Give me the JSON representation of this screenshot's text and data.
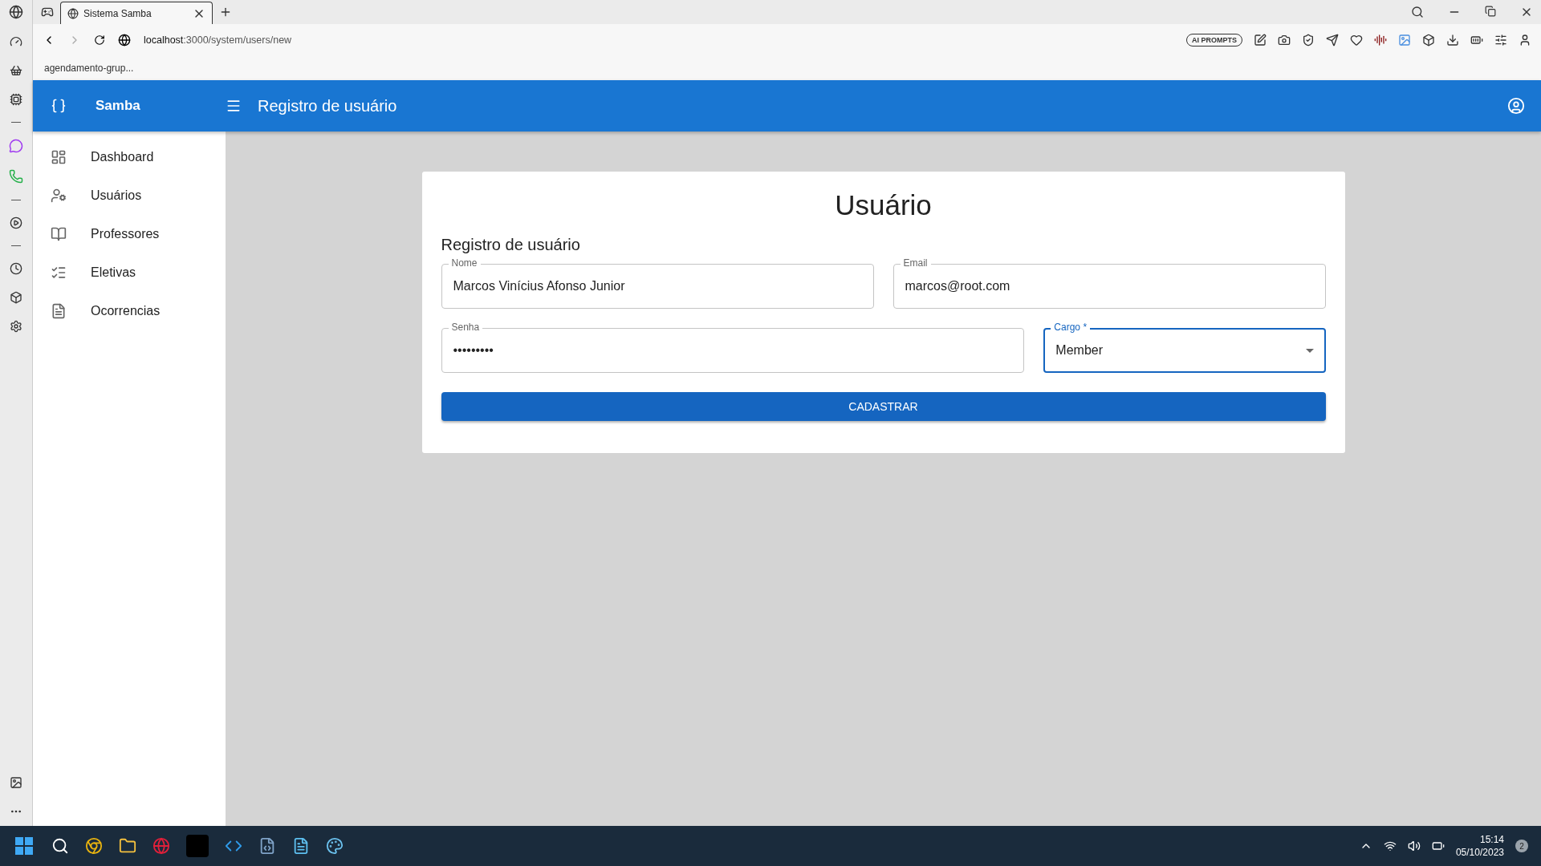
{
  "browser": {
    "tabs": [
      {
        "title": "Sistema Samba",
        "selected": true
      }
    ],
    "url_host": "localhost",
    "url_path": ":3000/system/users/new",
    "bookmarks": [
      "agendamento-grup..."
    ],
    "ai_prompts": "AI PROMPTS"
  },
  "app": {
    "brand": "Samba",
    "title": "Registro de usuário"
  },
  "sidebar": {
    "items": [
      {
        "label": "Dashboard"
      },
      {
        "label": "Usuários"
      },
      {
        "label": "Professores"
      },
      {
        "label": "Eletivas"
      },
      {
        "label": "Ocorrencias"
      }
    ]
  },
  "form": {
    "heading": "Usuário",
    "subheading": "Registro de usuário",
    "rows": [
      [
        {
          "kind": "text",
          "label": "Nome",
          "value": "Marcos Vinícius Afonso Junior",
          "focused": false
        },
        {
          "kind": "text",
          "label": "Email",
          "value": "marcos@root.com",
          "focused": false
        }
      ],
      [
        {
          "kind": "text",
          "label": "Senha",
          "value": "•••••••••",
          "focused": false
        },
        {
          "kind": "select",
          "label": "Cargo *",
          "value": "Member",
          "focused": true
        }
      ]
    ],
    "submit": "CADASTRAR"
  },
  "taskbar": {
    "time": "15:14",
    "date": "05/10/2023",
    "notifications": "2"
  }
}
